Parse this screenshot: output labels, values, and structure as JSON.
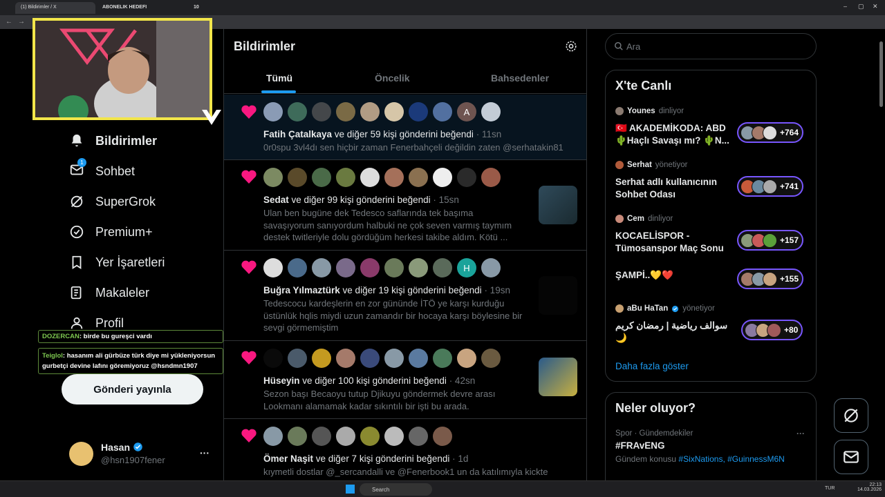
{
  "browser": {
    "tab1_label": "(1) Bildirimler / X",
    "tab2_label": "ABONELIK HEDEFI",
    "tab2_count": "10",
    "min": "–",
    "max": "▢",
    "close": "✕"
  },
  "overlay": {
    "chat": [
      {
        "user": "DOZERCAN",
        "text": ": birde bu gureşci vardı"
      },
      {
        "user": "Teiglol",
        "text": ": hasanım ali gürbüze türk diye mi yükleniyorsun gurbetçi devine lafını göremiyoruz @hsndmn1907"
      }
    ]
  },
  "nav": {
    "items": [
      {
        "label": "Bildirimler",
        "icon": "bell-icon"
      },
      {
        "label": "Sohbet",
        "icon": "mail-icon",
        "badge": "1"
      },
      {
        "label": "SuperGrok",
        "icon": "grok-icon"
      },
      {
        "label": "Premium+",
        "icon": "verified-icon"
      },
      {
        "label": "Yer İşaretleri",
        "icon": "bookmark-icon"
      },
      {
        "label": "Makaleler",
        "icon": "article-icon"
      },
      {
        "label": "Profil",
        "icon": "person-icon"
      }
    ],
    "post_button": "Gönderi yayınla",
    "account": {
      "name": "Hasan",
      "handle": "@hsn1907fener",
      "more": "···"
    }
  },
  "center": {
    "title": "Bildirimler",
    "tabs": [
      "Tümü",
      "Öncelik",
      "Bahsedenler"
    ],
    "notifications": [
      {
        "name": "Fatih Çatalkaya",
        "rest": " ve diğer 59 kişi gönderini beğendi",
        "time": " · 11sn",
        "body": "0r0spu 3vl4dı sen hiçbir zaman Fenerbahçeli değildin zaten @serhatakin81",
        "avatar_letters": [
          "",
          "",
          "",
          "",
          "",
          "",
          "",
          "",
          "A",
          ""
        ]
      },
      {
        "name": "Sedat",
        "rest": " ve diğer 99 kişi gönderini beğendi",
        "time": " · 15sn",
        "body": "Ulan ben bugüne dek Tedesco saflarında tek başıma savaşıyorum sanıyordum halbuki ne çok seven varmış taymım destek twitleriyle dolu gördüğüm herkesi takibe aldım. Kötü ...",
        "avatar_letters": [
          "",
          "",
          "",
          "",
          "",
          "",
          "",
          "",
          "",
          ""
        ]
      },
      {
        "name": "Buğra Yılmaztürk",
        "rest": " ve diğer 19 kişi gönderini beğendi",
        "time": " · 19sn",
        "body": "Tedescocu kardeşlerin en zor gününde İTÖ ye karşı kurduğu üstünlük hqlis miydi uzun zamandır bir hocaya karşı böylesine bir sevgi görmemiştim",
        "avatar_letters": [
          "",
          "",
          "",
          "",
          "",
          "",
          "",
          "",
          "H",
          ""
        ]
      },
      {
        "name": "Hüseyin",
        "rest": " ve diğer 100 kişi gönderini beğendi",
        "time": " · 42sn",
        "body": "Sezon başı Becaoyu tutup Djikuyu göndermek devre arası Lookmanı alamamak kadar sıkıntılı bir işti bu arada.",
        "avatar_letters": [
          "",
          "",
          "",
          "",
          "",
          "",
          "",
          "",
          "",
          ""
        ]
      },
      {
        "name": "Ömer Naşit",
        "rest": " ve diğer 7 kişi gönderini beğendi",
        "time": " · 1d",
        "body": "kıymetli dostlar @_sercandalli ve @Fenerbook1 un da katılımıyla kickte",
        "avatar_letters": [
          "",
          "",
          "",
          "",
          "",
          "",
          "",
          ""
        ]
      }
    ]
  },
  "right": {
    "search_placeholder": "Ara",
    "live_title": "X'te Canlı",
    "live": [
      {
        "host": "Younes",
        "role": " dinliyor",
        "title": "🇹🇷 AKADEMİKODA: ABD 🌵Haçlı Savaşı mı? 🌵N...",
        "count": "+764"
      },
      {
        "host": "Serhat",
        "role": " yönetiyor",
        "title": "Serhat adlı kullanıcının Sohbet Odası",
        "count": "+741"
      },
      {
        "host": "Cem",
        "role": " dinliyor",
        "title": "KOCAELİSPOR - Tümosanspor Maç Sonu",
        "count": "+157"
      },
      {
        "host": "",
        "role": "",
        "title": "ŞAMPİ..💛❤️",
        "count": "+155"
      },
      {
        "host": "aBu HaTan",
        "role": " yönetiyor",
        "title": "سوالف رياضية | رمضان كريم 🌙",
        "count": "+80"
      }
    ],
    "show_more": "Daha fazla göster",
    "trends_title": "Neler oluyor?",
    "trend": {
      "context": "Spor · Gündemdekiler",
      "name": "#FRAvENG",
      "sub": "Gündem konusu",
      "tags": "#SixNations, #GuinnessM6N"
    }
  },
  "taskbar": {
    "search": "Search",
    "lang": "TUR",
    "time": "22:13",
    "date": "14.03.2026"
  },
  "colors": {
    "accent": "#1d9bf0",
    "heart": "#f91880",
    "live_border": "#7856ff",
    "cam_border": "#f2e64a"
  }
}
